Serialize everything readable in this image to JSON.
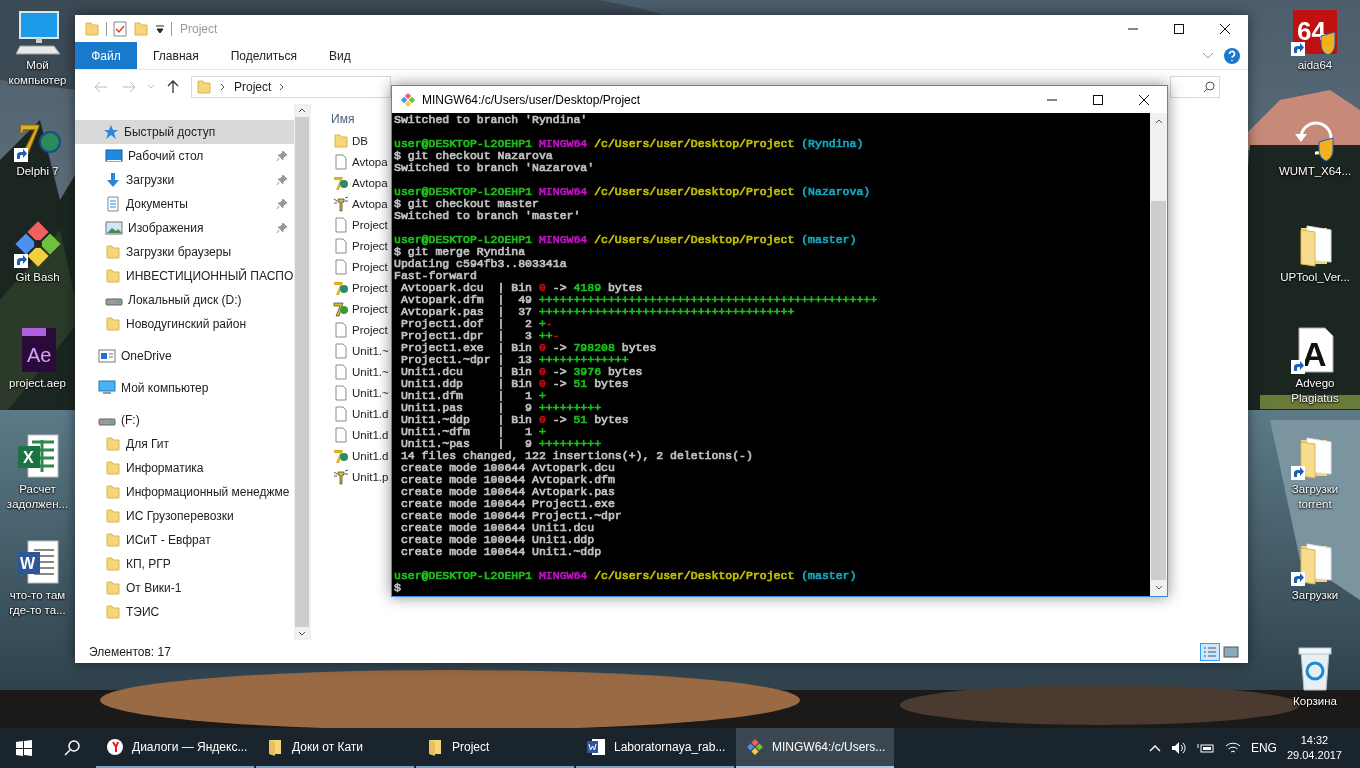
{
  "desktop": {
    "left_icons": [
      {
        "label": "Мой компьютер",
        "kind": "computer",
        "shortcut": false
      },
      {
        "label": "Delphi 7",
        "kind": "delphi",
        "glyph": "7",
        "shortcut": true
      },
      {
        "label": "Git Bash",
        "kind": "gitbash",
        "shortcut": true
      },
      {
        "label": "project.aep",
        "kind": "aep",
        "glyph": "Ae",
        "shortcut": false
      },
      {
        "label": "Расчет задолжен...",
        "kind": "excel",
        "glyph": "X",
        "shortcut": false
      },
      {
        "label": "что-то там где-то та...",
        "kind": "word",
        "glyph": "W",
        "shortcut": false
      }
    ],
    "right_icons": [
      {
        "label": "aida64",
        "kind": "aida",
        "glyph": "64",
        "shortcut": true
      },
      {
        "label": "WUMT_X64...",
        "kind": "wumt",
        "shortcut": false
      },
      {
        "label": "UPTool_Ver...",
        "kind": "folder",
        "shortcut": false
      },
      {
        "label": "Advego Plagiatus",
        "kind": "advego",
        "glyph": "A",
        "shortcut": true
      },
      {
        "label": "Загрузки torrent",
        "kind": "folder",
        "shortcut": true
      },
      {
        "label": "Загрузки",
        "kind": "folder",
        "shortcut": true
      },
      {
        "label": "Корзина",
        "kind": "recycle",
        "shortcut": false
      }
    ]
  },
  "explorer": {
    "title": "Project",
    "ribbon_tabs": [
      {
        "label": "Файл",
        "kind": "file"
      },
      {
        "label": "Главная",
        "kind": "tab"
      },
      {
        "label": "Поделиться",
        "kind": "tab"
      },
      {
        "label": "Вид",
        "kind": "tab"
      }
    ],
    "address": "Project",
    "nav_pane": [
      {
        "label": "Быстрый доступ",
        "kind": "star",
        "selected": true,
        "pinned": false,
        "children": [
          {
            "label": "Рабочий стол",
            "kind": "desktop",
            "selected": false,
            "pinned": true
          },
          {
            "label": "Загрузки",
            "kind": "download",
            "selected": false,
            "pinned": true
          },
          {
            "label": "Документы",
            "kind": "docs",
            "selected": false,
            "pinned": true
          },
          {
            "label": "Изображения",
            "kind": "images",
            "selected": false,
            "pinned": true
          },
          {
            "label": "Загрузки браузеры",
            "kind": "folder",
            "selected": false,
            "pinned": false
          },
          {
            "label": "ИНВЕСТИЦИОННЫЙ ПАСПО",
            "kind": "folder",
            "selected": false,
            "pinned": false
          },
          {
            "label": "Локальный диск (D:)",
            "kind": "drive",
            "selected": false,
            "pinned": false
          },
          {
            "label": "Новодугинский район",
            "kind": "folder",
            "selected": false,
            "pinned": false
          }
        ]
      },
      {
        "label": "OneDrive",
        "kind": "cloud",
        "selected": false,
        "pinned": false
      },
      {
        "label": "Мой компьютер",
        "kind": "computer",
        "selected": false,
        "pinned": false
      },
      {
        "label": "(F:)",
        "kind": "drive",
        "selected": false,
        "pinned": false,
        "children": [
          {
            "label": "Для Гит",
            "kind": "folder",
            "selected": false,
            "pinned": false
          },
          {
            "label": "Информатика",
            "kind": "folder",
            "selected": false,
            "pinned": false
          },
          {
            "label": "Информационный менеджме",
            "kind": "folder",
            "selected": false,
            "pinned": false
          },
          {
            "label": "ИС Грузоперевозки",
            "kind": "folder",
            "selected": false,
            "pinned": false
          },
          {
            "label": "ИСиТ - Евфрат",
            "kind": "folder",
            "selected": false,
            "pinned": false
          },
          {
            "label": "КП, РГР",
            "kind": "folder",
            "selected": false,
            "pinned": false
          },
          {
            "label": "От Вики-1",
            "kind": "folder",
            "selected": false,
            "pinned": false
          },
          {
            "label": "ТЭИС",
            "kind": "folder",
            "selected": false,
            "pinned": false
          }
        ]
      }
    ],
    "column": "Имя",
    "files": [
      {
        "name": "DB",
        "kind": "folder"
      },
      {
        "name": "Avtopa",
        "kind": "file"
      },
      {
        "name": "Avtopa",
        "kind": "delphi"
      },
      {
        "name": "Avtopa",
        "kind": "source"
      },
      {
        "name": "Project",
        "kind": "file"
      },
      {
        "name": "Project",
        "kind": "file"
      },
      {
        "name": "Project",
        "kind": "file"
      },
      {
        "name": "Project",
        "kind": "delphi"
      },
      {
        "name": "Project",
        "kind": "exe"
      },
      {
        "name": "Project",
        "kind": "file"
      },
      {
        "name": "Unit1.~",
        "kind": "file"
      },
      {
        "name": "Unit1.~",
        "kind": "file"
      },
      {
        "name": "Unit1.~",
        "kind": "file"
      },
      {
        "name": "Unit1.d",
        "kind": "file"
      },
      {
        "name": "Unit1.d",
        "kind": "file"
      },
      {
        "name": "Unit1.d",
        "kind": "delphi"
      },
      {
        "name": "Unit1.p",
        "kind": "source"
      }
    ],
    "status": "Элементов: 17"
  },
  "terminal": {
    "title": "MINGW64:/c/Users/user/Desktop/Project",
    "lines": [
      {
        "segments": [
          {
            "text": "Switched to branch 'Ryndina'",
            "color": "#c0c0c0"
          }
        ]
      },
      {
        "blank_before": true,
        "segments": [
          {
            "text": "user@DESKTOP-L2OEHP1 ",
            "color": "#1cc01c"
          },
          {
            "text": "MINGW64 ",
            "color": "#c010c0"
          },
          {
            "text": "/c/Users/user/Desktop/Project ",
            "color": "#c0c000"
          },
          {
            "text": "(Ryndina)",
            "color": "#10a8c0"
          }
        ]
      },
      {
        "segments": [
          {
            "text": "$ git checkout Nazarova",
            "color": "#c0c0c0"
          }
        ]
      },
      {
        "segments": [
          {
            "text": "Switched to branch 'Nazarova'",
            "color": "#c0c0c0"
          }
        ]
      },
      {
        "blank_before": true,
        "segments": [
          {
            "text": "user@DESKTOP-L2OEHP1 ",
            "color": "#1cc01c"
          },
          {
            "text": "MINGW64 ",
            "color": "#c010c0"
          },
          {
            "text": "/c/Users/user/Desktop/Project ",
            "color": "#c0c000"
          },
          {
            "text": "(Nazarova)",
            "color": "#10a8c0"
          }
        ]
      },
      {
        "segments": [
          {
            "text": "$ git checkout master",
            "color": "#c0c0c0"
          }
        ]
      },
      {
        "segments": [
          {
            "text": "Switched to branch 'master'",
            "color": "#c0c0c0"
          }
        ]
      },
      {
        "blank_before": true,
        "segments": [
          {
            "text": "user@DESKTOP-L2OEHP1 ",
            "color": "#1cc01c"
          },
          {
            "text": "MINGW64 ",
            "color": "#c010c0"
          },
          {
            "text": "/c/Users/user/Desktop/Project ",
            "color": "#c0c000"
          },
          {
            "text": "(master)",
            "color": "#10a8c0"
          }
        ]
      },
      {
        "segments": [
          {
            "text": "$ git merge Ryndina",
            "color": "#c0c0c0"
          }
        ]
      },
      {
        "segments": [
          {
            "text": "Updating c594fb3..803341a",
            "color": "#c0c0c0"
          }
        ]
      },
      {
        "segments": [
          {
            "text": "Fast-forward",
            "color": "#c0c0c0"
          }
        ]
      },
      {
        "segments": [
          {
            "text": " Avtopark.dcu  | Bin ",
            "color": "#c0c0c0"
          },
          {
            "text": "0",
            "color": "#c01010"
          },
          {
            "text": " -> ",
            "color": "#c0c0c0"
          },
          {
            "text": "4189",
            "color": "#1cc01c"
          },
          {
            "text": " bytes",
            "color": "#c0c0c0"
          }
        ]
      },
      {
        "segments": [
          {
            "text": " Avtopark.dfm  |  49 ",
            "color": "#c0c0c0"
          },
          {
            "text": "+++++++++++++++++++++++++++++++++++++++++++++++++",
            "color": "#1cc01c"
          }
        ]
      },
      {
        "segments": [
          {
            "text": " Avtopark.pas  |  37 ",
            "color": "#c0c0c0"
          },
          {
            "text": "+++++++++++++++++++++++++++++++++++++",
            "color": "#1cc01c"
          }
        ]
      },
      {
        "segments": [
          {
            "text": " Project1.dof  |   2 ",
            "color": "#c0c0c0"
          },
          {
            "text": "+",
            "color": "#1cc01c"
          },
          {
            "text": "-",
            "color": "#c01010"
          }
        ]
      },
      {
        "segments": [
          {
            "text": " Project1.dpr  |   3 ",
            "color": "#c0c0c0"
          },
          {
            "text": "++",
            "color": "#1cc01c"
          },
          {
            "text": "-",
            "color": "#c01010"
          }
        ]
      },
      {
        "segments": [
          {
            "text": " Project1.exe  | Bin ",
            "color": "#c0c0c0"
          },
          {
            "text": "0",
            "color": "#c01010"
          },
          {
            "text": " -> ",
            "color": "#c0c0c0"
          },
          {
            "text": "798208",
            "color": "#1cc01c"
          },
          {
            "text": " bytes",
            "color": "#c0c0c0"
          }
        ]
      },
      {
        "segments": [
          {
            "text": " Project1.~dpr |  13 ",
            "color": "#c0c0c0"
          },
          {
            "text": "+++++++++++++",
            "color": "#1cc01c"
          }
        ]
      },
      {
        "segments": [
          {
            "text": " Unit1.dcu     | Bin ",
            "color": "#c0c0c0"
          },
          {
            "text": "0",
            "color": "#c01010"
          },
          {
            "text": " -> ",
            "color": "#c0c0c0"
          },
          {
            "text": "3976",
            "color": "#1cc01c"
          },
          {
            "text": " bytes",
            "color": "#c0c0c0"
          }
        ]
      },
      {
        "segments": [
          {
            "text": " Unit1.ddp     | Bin ",
            "color": "#c0c0c0"
          },
          {
            "text": "0",
            "color": "#c01010"
          },
          {
            "text": " -> ",
            "color": "#c0c0c0"
          },
          {
            "text": "51",
            "color": "#1cc01c"
          },
          {
            "text": " bytes",
            "color": "#c0c0c0"
          }
        ]
      },
      {
        "segments": [
          {
            "text": " Unit1.dfm     |   1 ",
            "color": "#c0c0c0"
          },
          {
            "text": "+",
            "color": "#1cc01c"
          }
        ]
      },
      {
        "segments": [
          {
            "text": " Unit1.pas     |   9 ",
            "color": "#c0c0c0"
          },
          {
            "text": "+++++++++",
            "color": "#1cc01c"
          }
        ]
      },
      {
        "segments": [
          {
            "text": " Unit1.~ddp    | Bin ",
            "color": "#c0c0c0"
          },
          {
            "text": "0",
            "color": "#c01010"
          },
          {
            "text": " -> ",
            "color": "#c0c0c0"
          },
          {
            "text": "51",
            "color": "#1cc01c"
          },
          {
            "text": " bytes",
            "color": "#c0c0c0"
          }
        ]
      },
      {
        "segments": [
          {
            "text": " Unit1.~dfm    |   1 ",
            "color": "#c0c0c0"
          },
          {
            "text": "+",
            "color": "#1cc01c"
          }
        ]
      },
      {
        "segments": [
          {
            "text": " Unit1.~pas    |   9 ",
            "color": "#c0c0c0"
          },
          {
            "text": "+++++++++",
            "color": "#1cc01c"
          }
        ]
      },
      {
        "segments": [
          {
            "text": " 14 files changed, 122 insertions(+), 2 deletions(-)",
            "color": "#c0c0c0"
          }
        ]
      },
      {
        "segments": [
          {
            "text": " create mode 100644 Avtopark.dcu",
            "color": "#c0c0c0"
          }
        ]
      },
      {
        "segments": [
          {
            "text": " create mode 100644 Avtopark.dfm",
            "color": "#c0c0c0"
          }
        ]
      },
      {
        "segments": [
          {
            "text": " create mode 100644 Avtopark.pas",
            "color": "#c0c0c0"
          }
        ]
      },
      {
        "segments": [
          {
            "text": " create mode 100644 Project1.exe",
            "color": "#c0c0c0"
          }
        ]
      },
      {
        "segments": [
          {
            "text": " create mode 100644 Project1.~dpr",
            "color": "#c0c0c0"
          }
        ]
      },
      {
        "segments": [
          {
            "text": " create mode 100644 Unit1.dcu",
            "color": "#c0c0c0"
          }
        ]
      },
      {
        "segments": [
          {
            "text": " create mode 100644 Unit1.ddp",
            "color": "#c0c0c0"
          }
        ]
      },
      {
        "segments": [
          {
            "text": " create mode 100644 Unit1.~ddp",
            "color": "#c0c0c0"
          }
        ]
      },
      {
        "blank_before": true,
        "segments": [
          {
            "text": "user@DESKTOP-L2OEHP1 ",
            "color": "#1cc01c"
          },
          {
            "text": "MINGW64 ",
            "color": "#c010c0"
          },
          {
            "text": "/c/Users/user/Desktop/Project ",
            "color": "#c0c000"
          },
          {
            "text": "(master)",
            "color": "#10a8c0"
          }
        ]
      },
      {
        "segments": [
          {
            "text": "$",
            "color": "#c0c0c0"
          }
        ]
      }
    ]
  },
  "taskbar": {
    "tasks": [
      {
        "label": "Диалоги — Яндекс...",
        "kind": "browser",
        "selected": false
      },
      {
        "label": "Доки от Кати",
        "kind": "folder",
        "selected": false
      },
      {
        "label": "Project",
        "kind": "folder",
        "selected": false
      },
      {
        "label": "Laboratornaya_rab...",
        "kind": "word",
        "selected": false
      },
      {
        "label": "MINGW64:/c/Users...",
        "kind": "gitbash",
        "selected": true
      }
    ],
    "language": "ENG",
    "time": "14:32",
    "date": "29.04.2017"
  }
}
